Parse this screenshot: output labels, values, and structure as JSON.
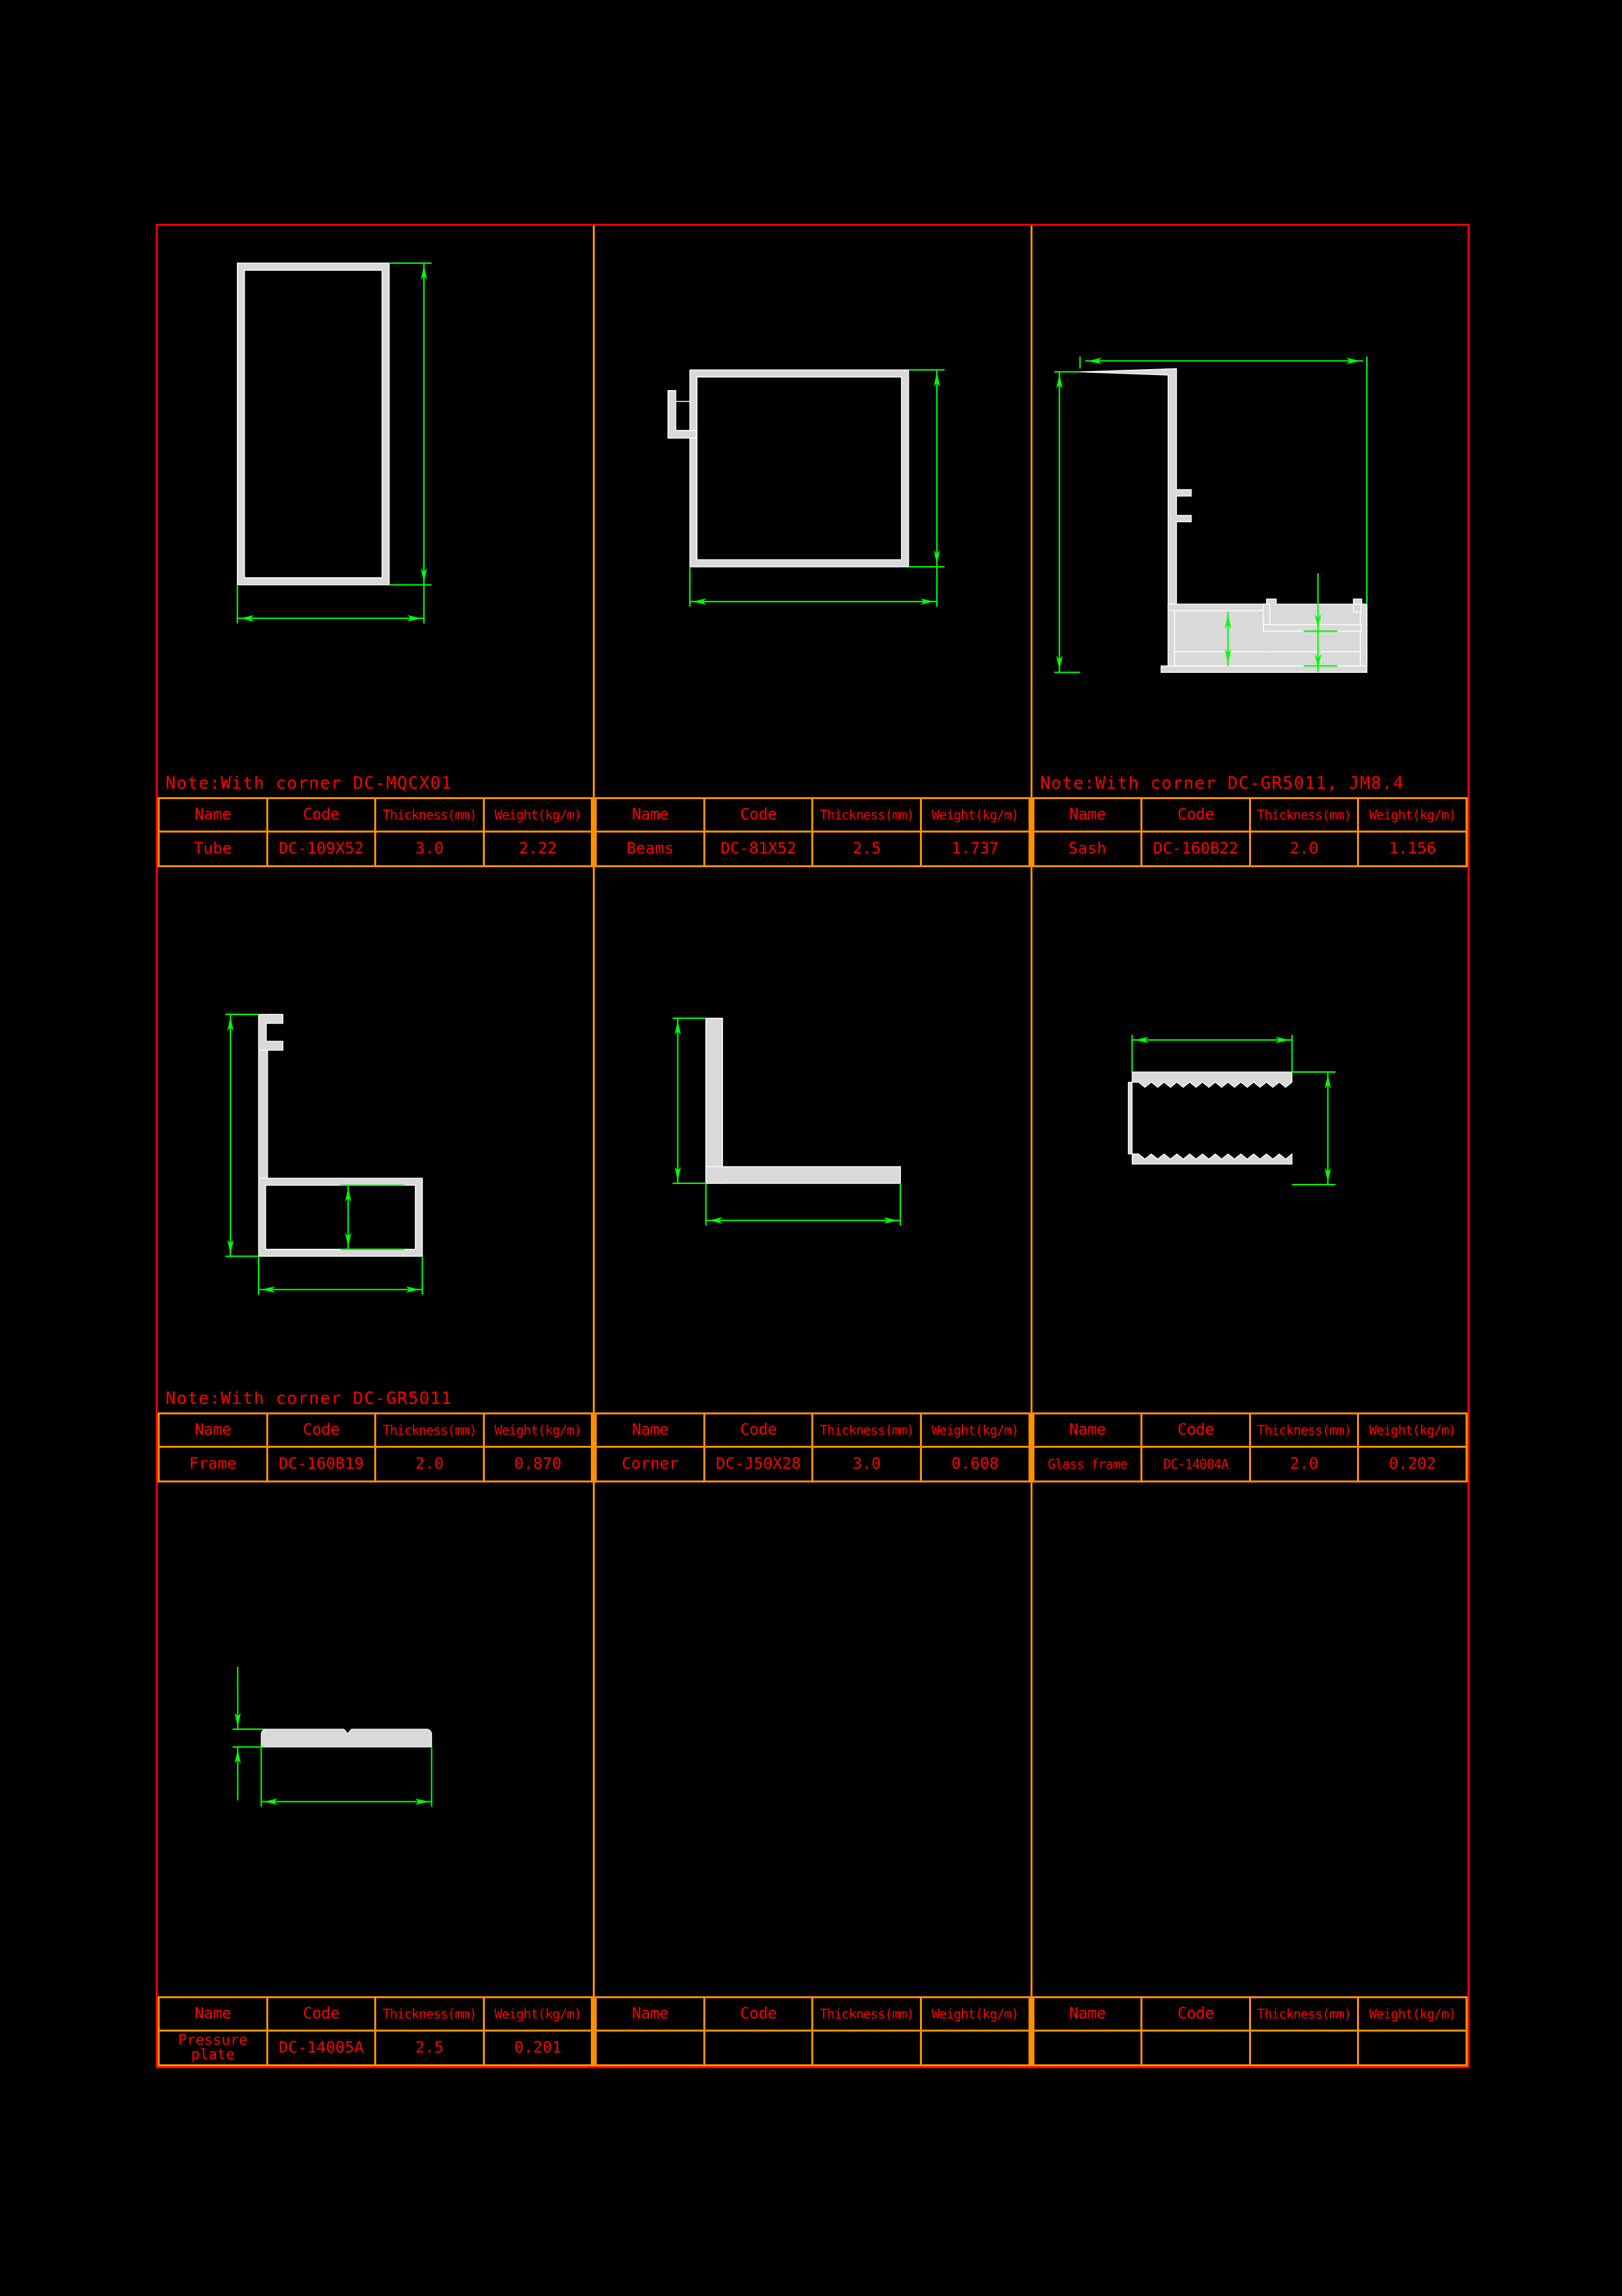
{
  "colors": {
    "background": "#000000",
    "sheet_border": "#ff0000",
    "table_line": "#ff9000",
    "text": "#ff0000",
    "profile_fill": "#d9d9d9",
    "profile_stroke": "#ffffff",
    "dimension": "#00ff00"
  },
  "table_headers": {
    "name": "Name",
    "code": "Code",
    "thickness": "Thickness(mm)",
    "weight": "Weight(kg/m)"
  },
  "cells": [
    {
      "id": "cell-1",
      "note": "Note:With corner DC-MQCX01",
      "drawing": "rectangular-hollow-tube",
      "spec": {
        "name": "Tube",
        "code": "DC-109X52",
        "thickness": "3.0",
        "weight": "2.22"
      }
    },
    {
      "id": "cell-2",
      "note": "",
      "drawing": "rectangular-tube-with-hook-flange",
      "spec": {
        "name": "Beams",
        "code": "DC-81X52",
        "thickness": "2.5",
        "weight": "1.737"
      }
    },
    {
      "id": "cell-3",
      "note": "Note:With corner DC-GR5011, JM8.4",
      "drawing": "sash-profile",
      "spec": {
        "name": "Sash",
        "code": "DC-160B22",
        "thickness": "2.0",
        "weight": "1.156"
      }
    },
    {
      "id": "cell-4",
      "note": "Note:With corner DC-GR5011",
      "drawing": "frame-L-profile-with-clip",
      "spec": {
        "name": "Frame",
        "code": "DC-160B19",
        "thickness": "2.0",
        "weight": "0.870"
      }
    },
    {
      "id": "cell-5",
      "note": "",
      "drawing": "corner-angle-profile",
      "spec": {
        "name": "Corner",
        "code": "DC-J50X28",
        "thickness": "3.0",
        "weight": "0.608"
      }
    },
    {
      "id": "cell-6",
      "note": "",
      "drawing": "glass-frame-serrated-channel",
      "spec": {
        "name": "Glass frame",
        "code": "DC-14004A",
        "thickness": "2.0",
        "weight": "0.202"
      }
    },
    {
      "id": "cell-7",
      "note": "",
      "drawing": "pressure-plate-flat-bar",
      "spec": {
        "name": "Pressure plate",
        "code": "DC-14005A",
        "thickness": "2.5",
        "weight": "0.201"
      }
    },
    {
      "id": "cell-8",
      "note": "",
      "drawing": "",
      "spec": {
        "name": "",
        "code": "",
        "thickness": "",
        "weight": ""
      }
    },
    {
      "id": "cell-9",
      "note": "",
      "drawing": "",
      "spec": {
        "name": "",
        "code": "",
        "thickness": "",
        "weight": ""
      }
    }
  ]
}
